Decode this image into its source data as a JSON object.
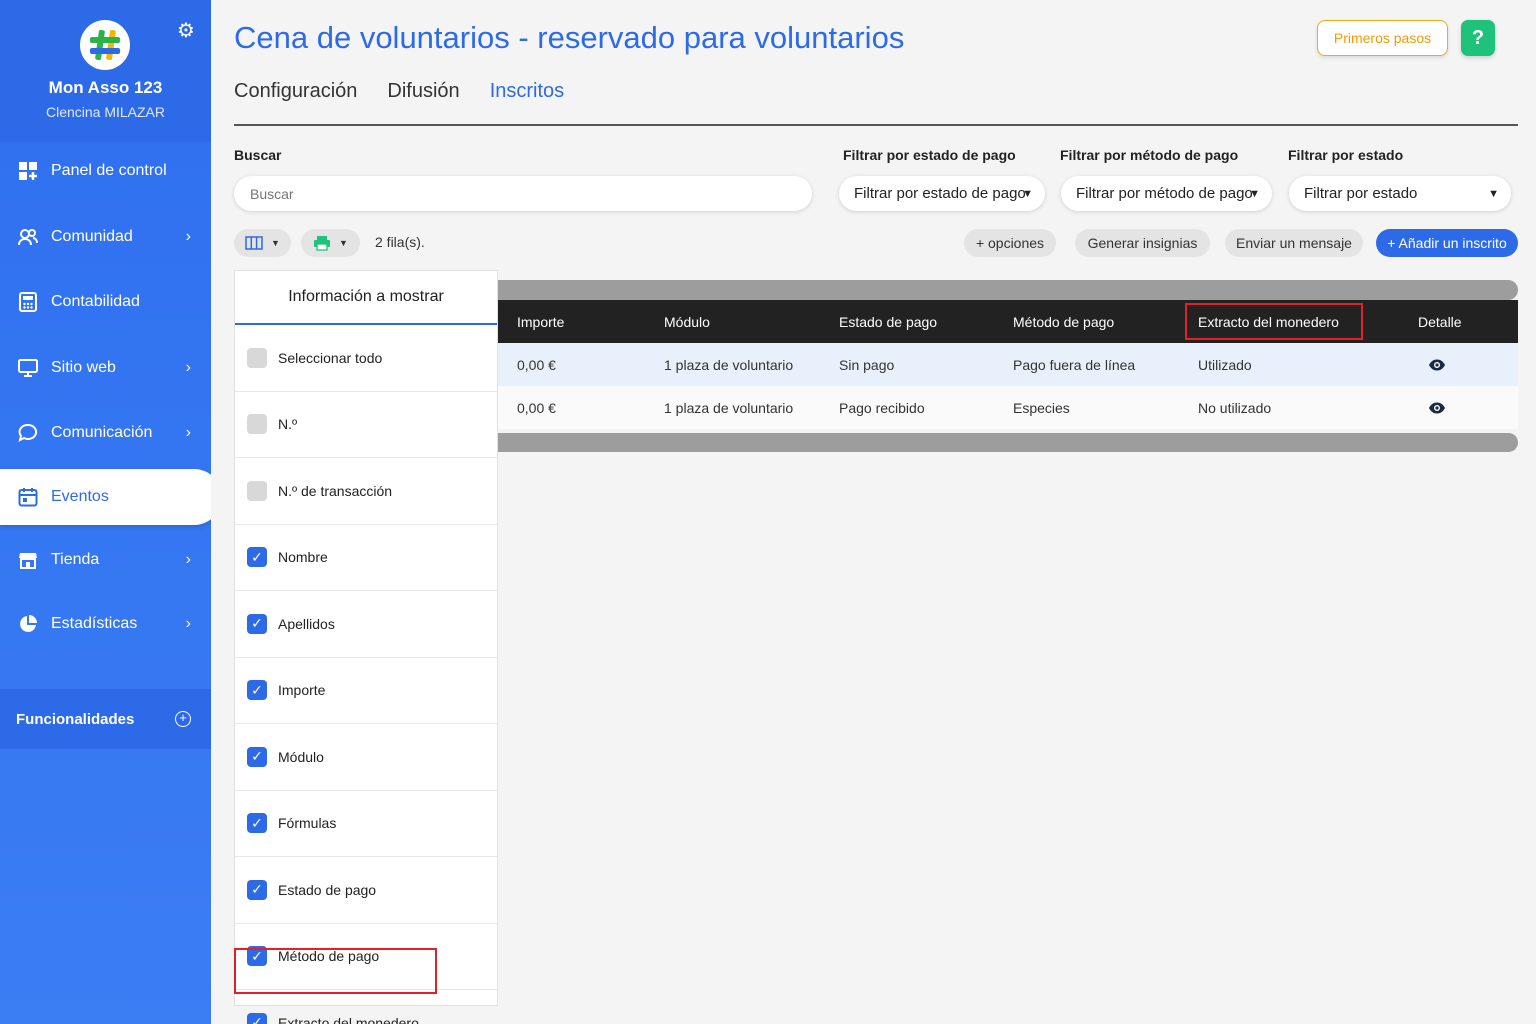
{
  "sidebar": {
    "org_name": "Mon Asso 123",
    "org_subtitle": "Clencina MILAZAR",
    "items": [
      {
        "label": "Panel de control",
        "icon": "dashboard-icon",
        "chevron": false
      },
      {
        "label": "Comunidad",
        "icon": "community-icon",
        "chevron": true
      },
      {
        "label": "Contabilidad",
        "icon": "calculator-icon",
        "chevron": false
      },
      {
        "label": "Sitio web",
        "icon": "monitor-icon",
        "chevron": true
      },
      {
        "label": "Comunicación",
        "icon": "chat-icon",
        "chevron": true
      },
      {
        "label": "Eventos",
        "icon": "calendar-icon",
        "chevron": false,
        "active": true
      },
      {
        "label": "Tienda",
        "icon": "store-icon",
        "chevron": true
      },
      {
        "label": "Estadísticas",
        "icon": "pie-chart-icon",
        "chevron": true
      }
    ],
    "functionalities_label": "Funcionalidades"
  },
  "header": {
    "title": "Cena de voluntarios - reservado para voluntarios",
    "first_steps_label": "Primeros pasos",
    "help_label": "?"
  },
  "tabs": [
    {
      "label": "Configuración",
      "active": false
    },
    {
      "label": "Difusión",
      "active": false
    },
    {
      "label": "Inscritos",
      "active": true
    }
  ],
  "filters": {
    "search_label": "Buscar",
    "search_placeholder": "Buscar",
    "payment_status_label": "Filtrar por estado de pago",
    "payment_status_value": "Filtrar por estado de pago",
    "payment_method_label": "Filtrar por método de pago",
    "payment_method_value": "Filtrar por método de pago",
    "status_label": "Filtrar por estado",
    "status_value": "Filtrar por estado"
  },
  "toolbar": {
    "rows_count": "2 fila(s).",
    "more_options": "+ opciones",
    "generate_badges": "Generar insignias",
    "send_message": "Enviar un mensaje",
    "add_registrant": "+ Añadir un inscrito"
  },
  "column_panel": {
    "title": "Información a mostrar",
    "options": [
      {
        "label": "Seleccionar todo",
        "checked": false
      },
      {
        "label": "N.º",
        "checked": false
      },
      {
        "label": "N.º de transacción",
        "checked": false
      },
      {
        "label": "Nombre",
        "checked": true
      },
      {
        "label": "Apellidos",
        "checked": true
      },
      {
        "label": "Importe",
        "checked": true
      },
      {
        "label": "Módulo",
        "checked": true
      },
      {
        "label": "Fórmulas",
        "checked": true
      },
      {
        "label": "Estado de pago",
        "checked": true
      },
      {
        "label": "Método de pago",
        "checked": true
      },
      {
        "label": "Extracto del monedero",
        "checked": true
      }
    ]
  },
  "table": {
    "headers": [
      "Importe",
      "Módulo",
      "Estado de pago",
      "Método de pago",
      "Extracto del monedero",
      "Detalle"
    ],
    "rows": [
      [
        "0,00 €",
        "1 plaza de voluntario",
        "Sin pago",
        "Pago fuera de línea",
        "Utilizado"
      ],
      [
        "0,00 €",
        "1 plaza de voluntario",
        "Pago recibido",
        "Especies",
        "No utilizado"
      ]
    ]
  },
  "colors": {
    "primary": "#2d6ae8",
    "accent_orange": "#f29a00",
    "help_green": "#1ec27a",
    "highlight_red": "#e0202a"
  }
}
